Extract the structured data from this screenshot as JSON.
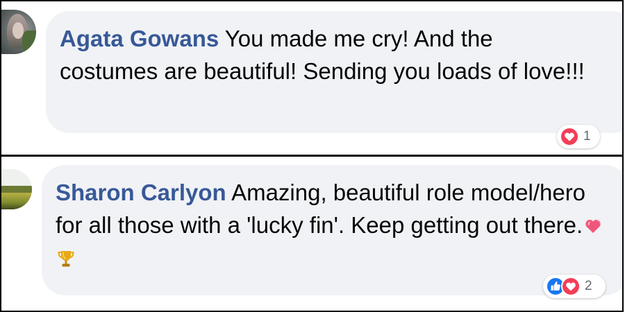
{
  "comments": [
    {
      "author": "Agata Gowans",
      "text": "You made me cry! And the costumes are beautiful! Sending you loads of love!!!",
      "reactions": {
        "icons": [
          "love-icon"
        ],
        "count": "1"
      }
    },
    {
      "author": "Sharon Carlyon",
      "text": "Amazing, beautiful role model/hero for all those with a 'lucky fin'. Keep getting out there.",
      "emojis": [
        "heart-emoji",
        "trophy-emoji"
      ],
      "reactions": {
        "icons": [
          "like-icon",
          "love-icon"
        ],
        "count": "2"
      }
    }
  ],
  "colors": {
    "author": "#385898",
    "bubble": "#f0f2f5",
    "text": "#050505",
    "like": "#1877f2",
    "love": "#f33e58",
    "count": "#65676b"
  }
}
